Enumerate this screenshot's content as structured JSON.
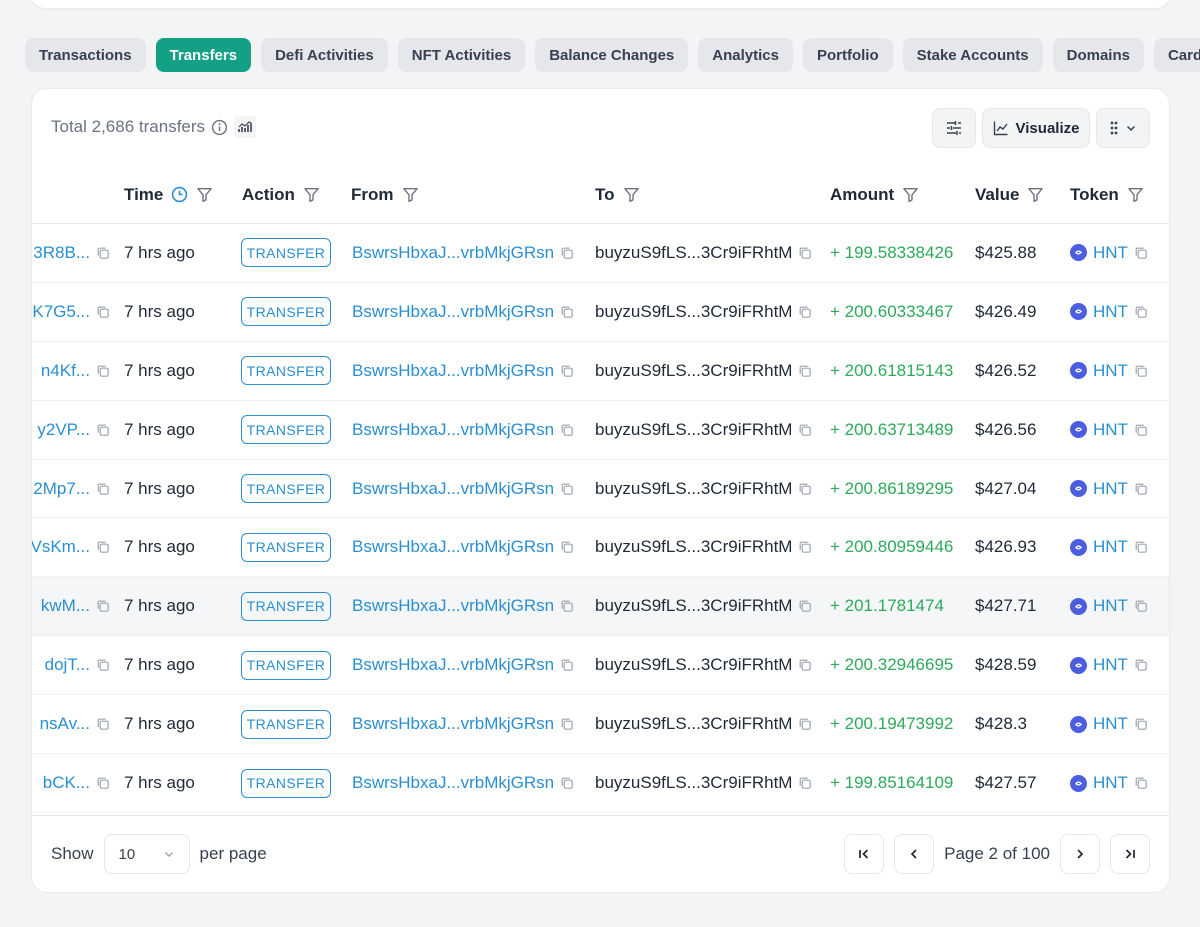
{
  "tabs": [
    "Transactions",
    "Transfers",
    "Defi Activities",
    "NFT Activities",
    "Balance Changes",
    "Analytics",
    "Portfolio",
    "Stake Accounts",
    "Domains",
    "Cards"
  ],
  "active_tab": "Transfers",
  "header": {
    "total_text": "Total 2,686 transfers",
    "visualize_label": "Visualize"
  },
  "columns": {
    "time": "Time",
    "action": "Action",
    "from": "From",
    "to": "To",
    "amount": "Amount",
    "value": "Value",
    "token": "Token"
  },
  "rows": [
    {
      "sig": "3R8B...",
      "time": "7 hrs ago",
      "action": "TRANSFER",
      "from": "BswrsHbxaJ...vrbMkjGRsn",
      "to": "buyzuS9fLS...3Cr9iFRhtM",
      "amount": "+ 199.58338426",
      "value": "$425.88",
      "token": "HNT"
    },
    {
      "sig": "K7G5...",
      "time": "7 hrs ago",
      "action": "TRANSFER",
      "from": "BswrsHbxaJ...vrbMkjGRsn",
      "to": "buyzuS9fLS...3Cr9iFRhtM",
      "amount": "+ 200.60333467",
      "value": "$426.49",
      "token": "HNT"
    },
    {
      "sig": "n4Kf...",
      "time": "7 hrs ago",
      "action": "TRANSFER",
      "from": "BswrsHbxaJ...vrbMkjGRsn",
      "to": "buyzuS9fLS...3Cr9iFRhtM",
      "amount": "+ 200.61815143",
      "value": "$426.52",
      "token": "HNT"
    },
    {
      "sig": "y2VP...",
      "time": "7 hrs ago",
      "action": "TRANSFER",
      "from": "BswrsHbxaJ...vrbMkjGRsn",
      "to": "buyzuS9fLS...3Cr9iFRhtM",
      "amount": "+ 200.63713489",
      "value": "$426.56",
      "token": "HNT"
    },
    {
      "sig": "2Mp7...",
      "time": "7 hrs ago",
      "action": "TRANSFER",
      "from": "BswrsHbxaJ...vrbMkjGRsn",
      "to": "buyzuS9fLS...3Cr9iFRhtM",
      "amount": "+ 200.86189295",
      "value": "$427.04",
      "token": "HNT"
    },
    {
      "sig": "VsKm...",
      "time": "7 hrs ago",
      "action": "TRANSFER",
      "from": "BswrsHbxaJ...vrbMkjGRsn",
      "to": "buyzuS9fLS...3Cr9iFRhtM",
      "amount": "+ 200.80959446",
      "value": "$426.93",
      "token": "HNT"
    },
    {
      "sig": "kwM...",
      "time": "7 hrs ago",
      "action": "TRANSFER",
      "from": "BswrsHbxaJ...vrbMkjGRsn",
      "to": "buyzuS9fLS...3Cr9iFRhtM",
      "amount": "+ 201.1781474",
      "value": "$427.71",
      "token": "HNT"
    },
    {
      "sig": "dojT...",
      "time": "7 hrs ago",
      "action": "TRANSFER",
      "from": "BswrsHbxaJ...vrbMkjGRsn",
      "to": "buyzuS9fLS...3Cr9iFRhtM",
      "amount": "+ 200.32946695",
      "value": "$428.59",
      "token": "HNT"
    },
    {
      "sig": "nsAv...",
      "time": "7 hrs ago",
      "action": "TRANSFER",
      "from": "BswrsHbxaJ...vrbMkjGRsn",
      "to": "buyzuS9fLS...3Cr9iFRhtM",
      "amount": "+ 200.19473992",
      "value": "$428.3",
      "token": "HNT"
    },
    {
      "sig": "bCK...",
      "time": "7 hrs ago",
      "action": "TRANSFER",
      "from": "BswrsHbxaJ...vrbMkjGRsn",
      "to": "buyzuS9fLS...3Cr9iFRhtM",
      "amount": "+ 199.85164109",
      "value": "$427.57",
      "token": "HNT"
    }
  ],
  "highlighted_row": 6,
  "footer": {
    "show_label": "Show",
    "per_page_value": "10",
    "per_page_label": "per page",
    "page_text": "Page 2 of 100"
  }
}
